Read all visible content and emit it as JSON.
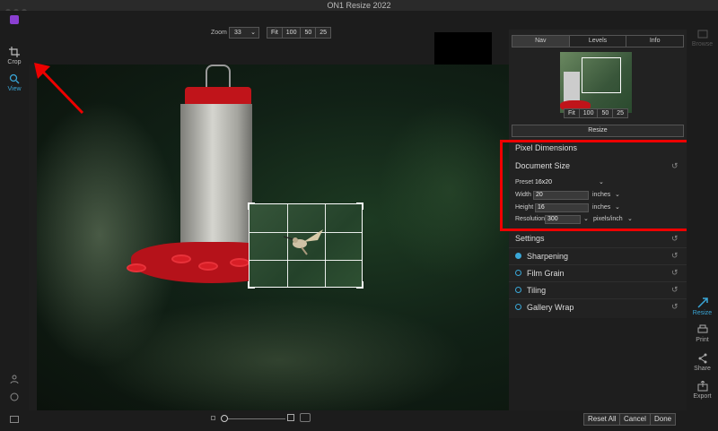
{
  "window": {
    "title": "ON1 Resize 2022"
  },
  "toolbar": {
    "zoom_label": "Zoom",
    "zoom_value": "33",
    "zoom_buttons": [
      "Fit",
      "100",
      "50",
      "25"
    ]
  },
  "left_tools": [
    {
      "label": "Crop",
      "icon": "crop-icon"
    },
    {
      "label": "View",
      "icon": "view-icon"
    }
  ],
  "nav_panel": {
    "tabs": [
      "Nav",
      "Levels",
      "Info"
    ],
    "active_tab": "Nav",
    "zoom_buttons": [
      "Fit",
      "100",
      "50",
      "25"
    ],
    "resize_label": "Resize"
  },
  "pixel_dimensions": {
    "header": "Pixel Dimensions",
    "document_size": "Document Size",
    "preset_label": "Preset",
    "preset_value": "16x20",
    "width_label": "Width",
    "width_value": "20",
    "width_unit": "inches",
    "height_label": "Height",
    "height_value": "16",
    "height_unit": "inches",
    "resolution_label": "Resolution",
    "resolution_value": "300",
    "resolution_unit": "pixels/inch"
  },
  "settings": {
    "header": "Settings",
    "items": [
      {
        "label": "Sharpening",
        "enabled": true
      },
      {
        "label": "Film Grain",
        "enabled": false
      },
      {
        "label": "Tiling",
        "enabled": false
      },
      {
        "label": "Gallery Wrap",
        "enabled": false
      }
    ]
  },
  "right_tools": [
    {
      "label": "Browse",
      "icon": "browse-icon"
    },
    {
      "label": "Resize",
      "icon": "resize-icon"
    },
    {
      "label": "Print",
      "icon": "print-icon"
    },
    {
      "label": "Share",
      "icon": "share-icon"
    },
    {
      "label": "Export",
      "icon": "export-icon"
    }
  ],
  "bottom": {
    "reset_all": "Reset All",
    "cancel": "Cancel",
    "done": "Done"
  },
  "colors": {
    "accent": "#3aa7d8",
    "annotation_red": "#e00000",
    "app_icon": "#8a3fd1"
  }
}
